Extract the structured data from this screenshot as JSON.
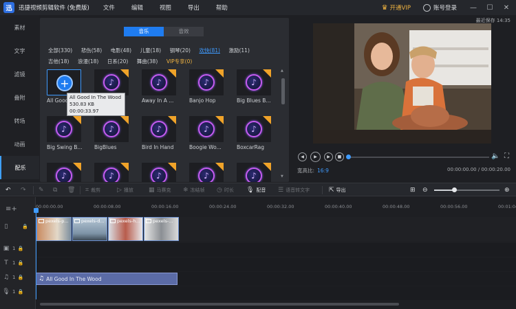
{
  "app": {
    "title": "迅捷视频剪辑软件 (免费版)",
    "logo_text": "迅",
    "menu": [
      "文件",
      "编辑",
      "视图",
      "导出",
      "帮助"
    ],
    "vip_label": "开通VIP",
    "account_label": "账号登录",
    "window_controls": [
      "—",
      "☐",
      "✕"
    ]
  },
  "nav": {
    "items": [
      {
        "label": "素材",
        "active": false
      },
      {
        "label": "文字",
        "active": false
      },
      {
        "label": "滤镜",
        "active": false
      },
      {
        "label": "叠附",
        "active": false
      },
      {
        "label": "转场",
        "active": false
      },
      {
        "label": "动画",
        "active": false
      },
      {
        "label": "配乐",
        "active": true
      }
    ]
  },
  "media": {
    "tabs": [
      {
        "label": "音乐",
        "active": true
      },
      {
        "label": "音效",
        "active": false
      }
    ],
    "categories_row1": [
      "全部(330)",
      "悲伤(58)",
      "电影(48)",
      "儿童(18)",
      "钢琴(20)",
      "欢快(81)",
      "激励(11)"
    ],
    "categories_row2": [
      "吉他(18)",
      "浪漫(18)",
      "日系(20)",
      "舞曲(38)",
      "VIP专享(0)"
    ],
    "active_category": "欢快(81)",
    "tiles_row1": [
      "All Good In The Wood",
      "",
      "Away In A ...",
      "Banjo Hop",
      "Big Blues B..."
    ],
    "tiles_row2": [
      "Big Swing B...",
      "BigBlues",
      "Bird In Hand",
      "Boogie Wo...",
      "BoxcarRag"
    ],
    "tooltip": {
      "title": "All Good In The Wood",
      "size": "530.83 KB",
      "duration": "00:00:33.97"
    }
  },
  "preview": {
    "autosave": "最近保存 14:35",
    "aspect_label": "宽高比:",
    "aspect_value": "16:9",
    "timecode": "00:00:00.00 / 00:00:20.00",
    "progress": 0.0
  },
  "toolbar": {
    "buttons": [
      "裁剪",
      "播放",
      "马赛克",
      "冻结帧",
      "时长",
      "配音",
      "语音转文字",
      "导出"
    ],
    "zoom_level": 0.3
  },
  "timeline": {
    "ruler": [
      "00:00:00.00",
      "00:00:08.00",
      "00:00:16.00",
      "00:00:24.00",
      "00:00:32.00",
      "00:00:40.00",
      "00:00:48.00",
      "00:00:56.00",
      "00:01:04"
    ],
    "video_clips": [
      "pexels-p...",
      "pexels-d...",
      "pexels-h...",
      "pexels-..."
    ],
    "music_clip": "All Good In The Wood",
    "track_count_pip": "1",
    "track_count_text": "1",
    "track_count_music": "1",
    "track_count_rec": "1"
  },
  "colors": {
    "accent": "#1f7cf0",
    "vip": "#f0b341",
    "note_ring": "#c75bf0"
  }
}
